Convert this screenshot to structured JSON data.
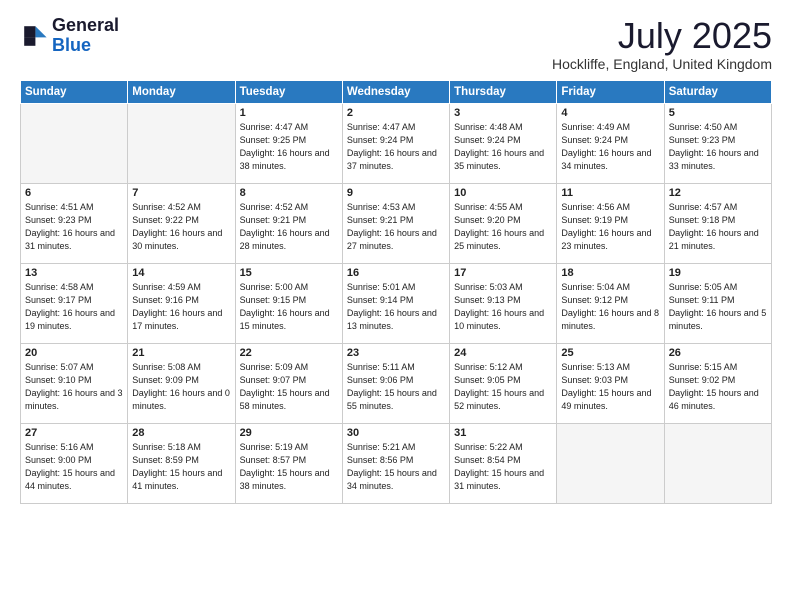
{
  "header": {
    "logo_general": "General",
    "logo_blue": "Blue",
    "title": "July 2025",
    "subtitle": "Hockliffe, England, United Kingdom"
  },
  "weekdays": [
    "Sunday",
    "Monday",
    "Tuesday",
    "Wednesday",
    "Thursday",
    "Friday",
    "Saturday"
  ],
  "weeks": [
    [
      {
        "day": null
      },
      {
        "day": null
      },
      {
        "day": 1,
        "sunrise": "4:47 AM",
        "sunset": "9:25 PM",
        "daylight": "16 hours and 38 minutes."
      },
      {
        "day": 2,
        "sunrise": "4:47 AM",
        "sunset": "9:24 PM",
        "daylight": "16 hours and 37 minutes."
      },
      {
        "day": 3,
        "sunrise": "4:48 AM",
        "sunset": "9:24 PM",
        "daylight": "16 hours and 35 minutes."
      },
      {
        "day": 4,
        "sunrise": "4:49 AM",
        "sunset": "9:24 PM",
        "daylight": "16 hours and 34 minutes."
      },
      {
        "day": 5,
        "sunrise": "4:50 AM",
        "sunset": "9:23 PM",
        "daylight": "16 hours and 33 minutes."
      }
    ],
    [
      {
        "day": 6,
        "sunrise": "4:51 AM",
        "sunset": "9:23 PM",
        "daylight": "16 hours and 31 minutes."
      },
      {
        "day": 7,
        "sunrise": "4:52 AM",
        "sunset": "9:22 PM",
        "daylight": "16 hours and 30 minutes."
      },
      {
        "day": 8,
        "sunrise": "4:52 AM",
        "sunset": "9:21 PM",
        "daylight": "16 hours and 28 minutes."
      },
      {
        "day": 9,
        "sunrise": "4:53 AM",
        "sunset": "9:21 PM",
        "daylight": "16 hours and 27 minutes."
      },
      {
        "day": 10,
        "sunrise": "4:55 AM",
        "sunset": "9:20 PM",
        "daylight": "16 hours and 25 minutes."
      },
      {
        "day": 11,
        "sunrise": "4:56 AM",
        "sunset": "9:19 PM",
        "daylight": "16 hours and 23 minutes."
      },
      {
        "day": 12,
        "sunrise": "4:57 AM",
        "sunset": "9:18 PM",
        "daylight": "16 hours and 21 minutes."
      }
    ],
    [
      {
        "day": 13,
        "sunrise": "4:58 AM",
        "sunset": "9:17 PM",
        "daylight": "16 hours and 19 minutes."
      },
      {
        "day": 14,
        "sunrise": "4:59 AM",
        "sunset": "9:16 PM",
        "daylight": "16 hours and 17 minutes."
      },
      {
        "day": 15,
        "sunrise": "5:00 AM",
        "sunset": "9:15 PM",
        "daylight": "16 hours and 15 minutes."
      },
      {
        "day": 16,
        "sunrise": "5:01 AM",
        "sunset": "9:14 PM",
        "daylight": "16 hours and 13 minutes."
      },
      {
        "day": 17,
        "sunrise": "5:03 AM",
        "sunset": "9:13 PM",
        "daylight": "16 hours and 10 minutes."
      },
      {
        "day": 18,
        "sunrise": "5:04 AM",
        "sunset": "9:12 PM",
        "daylight": "16 hours and 8 minutes."
      },
      {
        "day": 19,
        "sunrise": "5:05 AM",
        "sunset": "9:11 PM",
        "daylight": "16 hours and 5 minutes."
      }
    ],
    [
      {
        "day": 20,
        "sunrise": "5:07 AM",
        "sunset": "9:10 PM",
        "daylight": "16 hours and 3 minutes."
      },
      {
        "day": 21,
        "sunrise": "5:08 AM",
        "sunset": "9:09 PM",
        "daylight": "16 hours and 0 minutes."
      },
      {
        "day": 22,
        "sunrise": "5:09 AM",
        "sunset": "9:07 PM",
        "daylight": "15 hours and 58 minutes."
      },
      {
        "day": 23,
        "sunrise": "5:11 AM",
        "sunset": "9:06 PM",
        "daylight": "15 hours and 55 minutes."
      },
      {
        "day": 24,
        "sunrise": "5:12 AM",
        "sunset": "9:05 PM",
        "daylight": "15 hours and 52 minutes."
      },
      {
        "day": 25,
        "sunrise": "5:13 AM",
        "sunset": "9:03 PM",
        "daylight": "15 hours and 49 minutes."
      },
      {
        "day": 26,
        "sunrise": "5:15 AM",
        "sunset": "9:02 PM",
        "daylight": "15 hours and 46 minutes."
      }
    ],
    [
      {
        "day": 27,
        "sunrise": "5:16 AM",
        "sunset": "9:00 PM",
        "daylight": "15 hours and 44 minutes."
      },
      {
        "day": 28,
        "sunrise": "5:18 AM",
        "sunset": "8:59 PM",
        "daylight": "15 hours and 41 minutes."
      },
      {
        "day": 29,
        "sunrise": "5:19 AM",
        "sunset": "8:57 PM",
        "daylight": "15 hours and 38 minutes."
      },
      {
        "day": 30,
        "sunrise": "5:21 AM",
        "sunset": "8:56 PM",
        "daylight": "15 hours and 34 minutes."
      },
      {
        "day": 31,
        "sunrise": "5:22 AM",
        "sunset": "8:54 PM",
        "daylight": "15 hours and 31 minutes."
      },
      {
        "day": null
      },
      {
        "day": null
      }
    ]
  ]
}
